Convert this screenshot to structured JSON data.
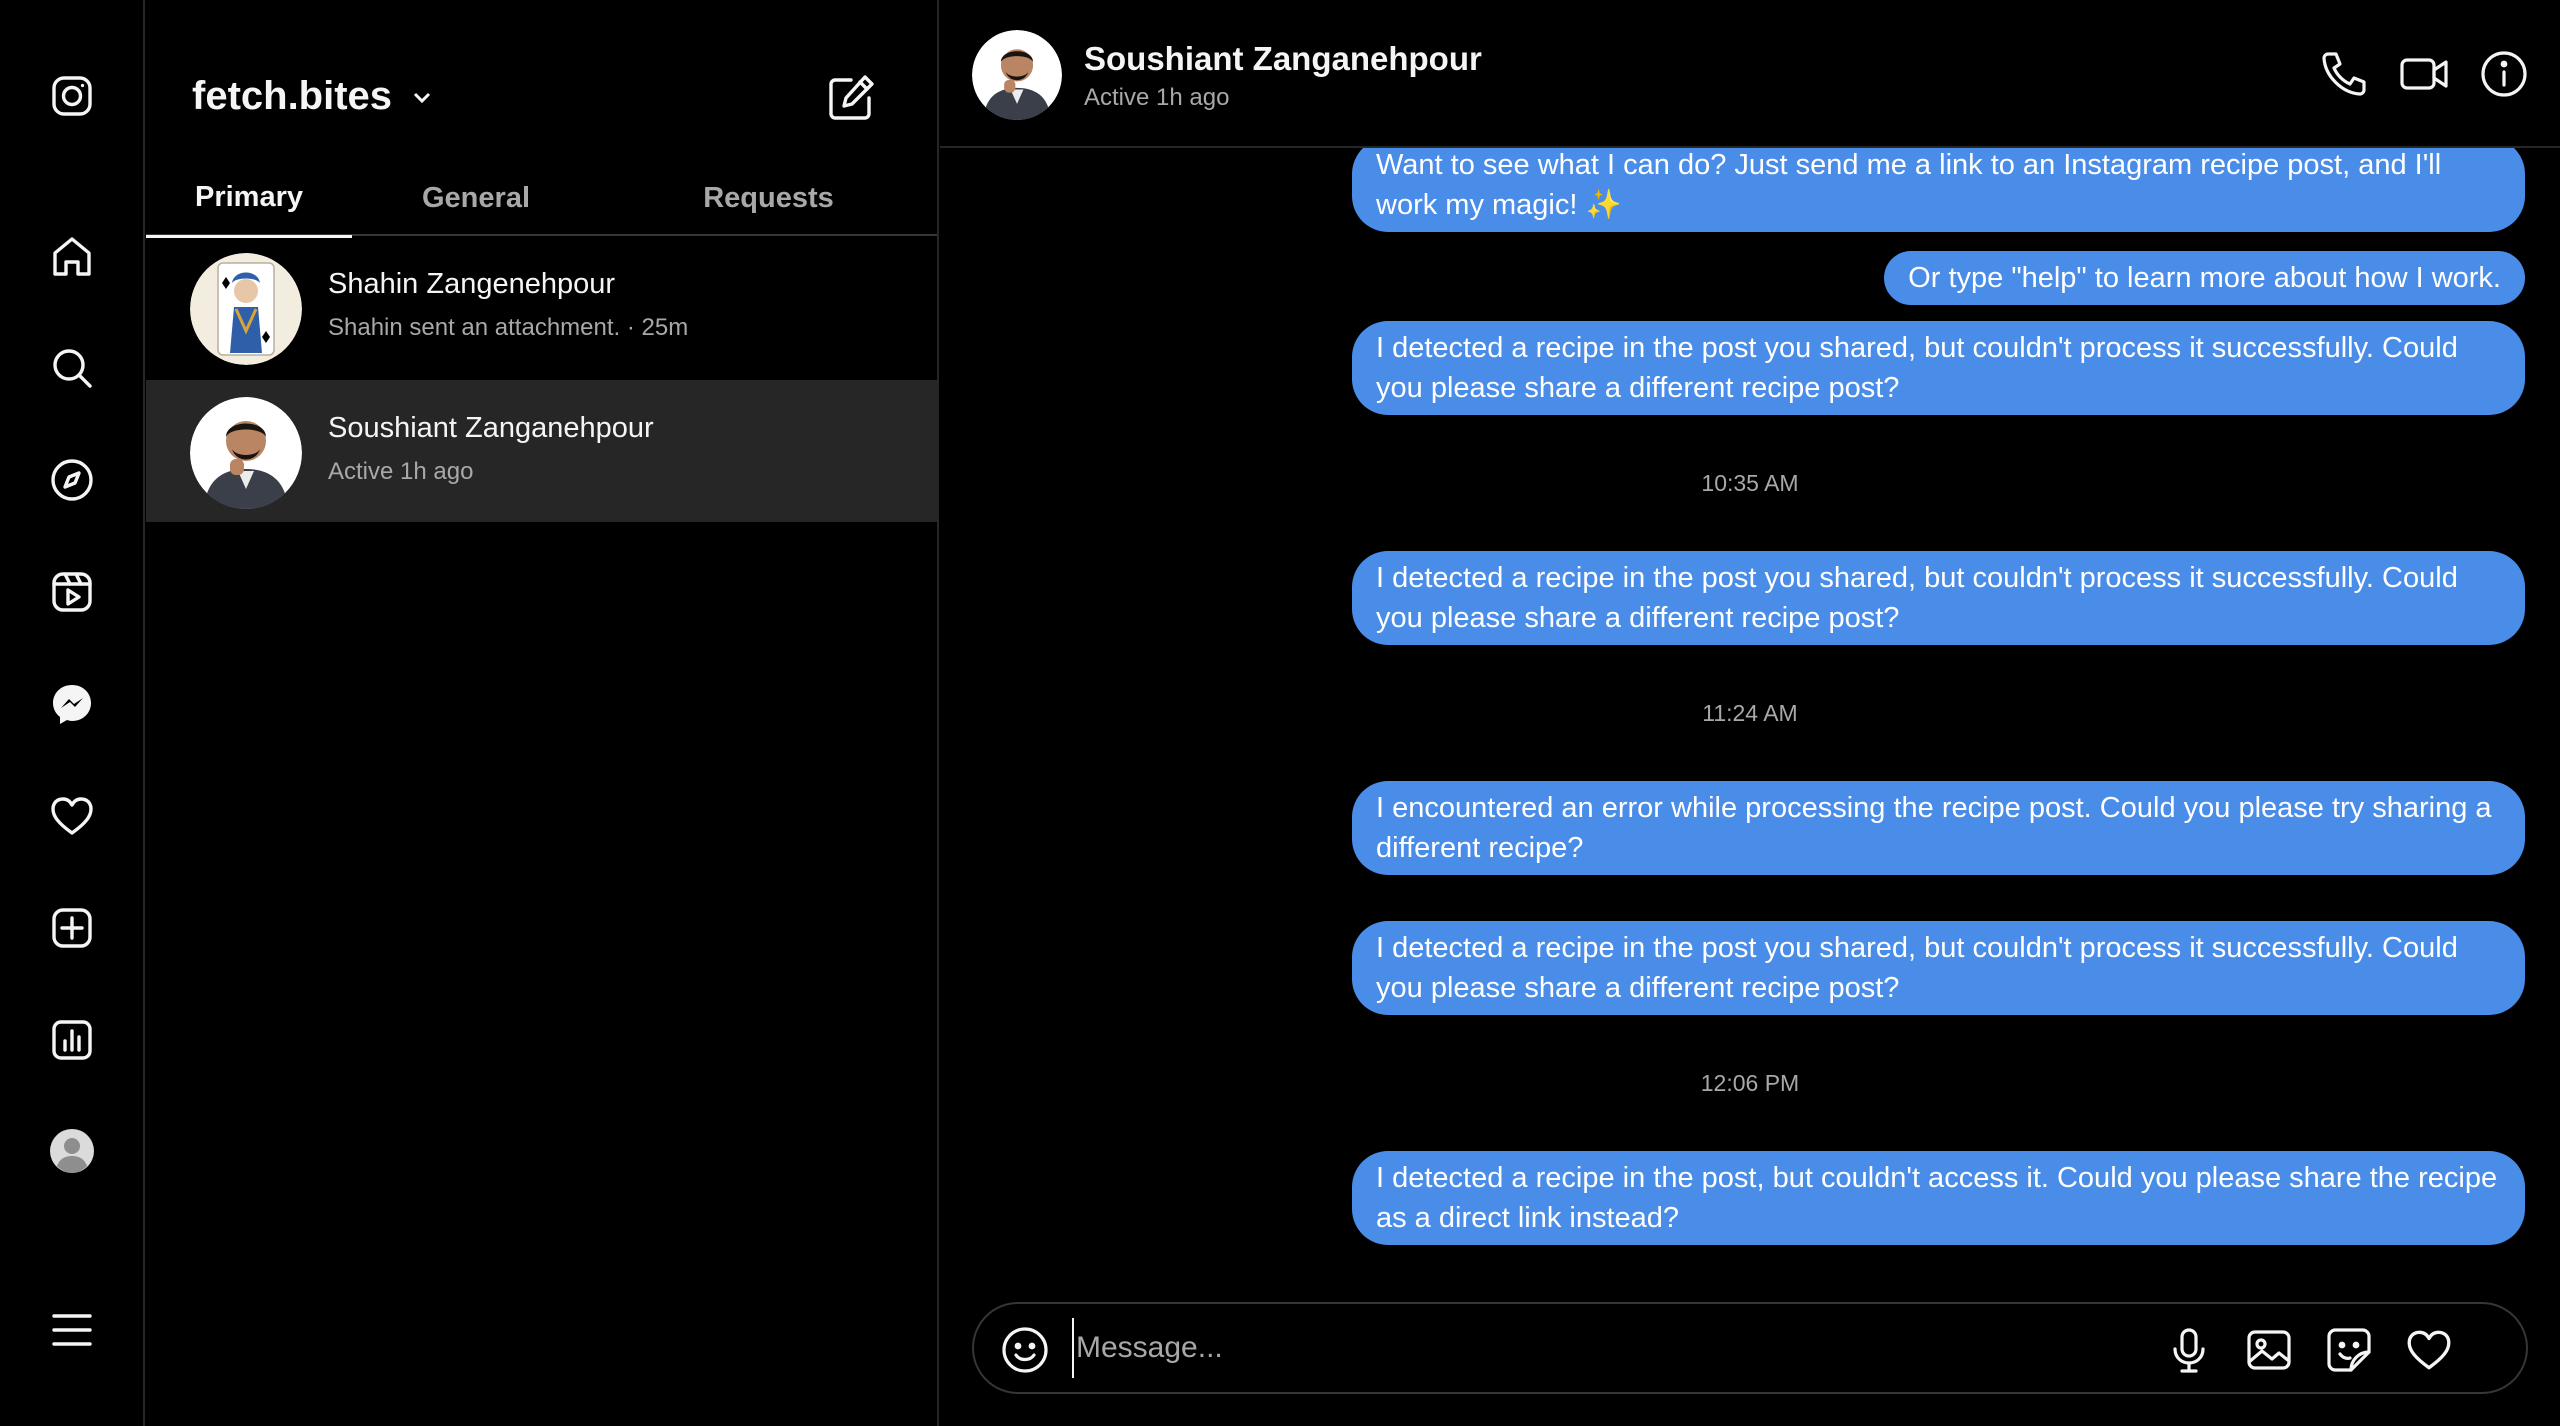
{
  "account": {
    "username": "fetch.bites"
  },
  "tabs": [
    {
      "label": "Primary",
      "active": true
    },
    {
      "label": "General",
      "active": false
    },
    {
      "label": "Requests",
      "active": false
    }
  ],
  "threads": [
    {
      "name": "Shahin Zangenehpour",
      "subtitle": "Shahin sent an attachment. · 25m",
      "selected": false
    },
    {
      "name": "Soushiant Zanganehpour",
      "subtitle": "Active 1h ago",
      "selected": true
    }
  ],
  "chat": {
    "name": "Soushiant Zanganehpour",
    "status": "Active 1h ago",
    "items": [
      {
        "kind": "message",
        "text": "Want to see what I can do? Just send me a link to an Instagram recipe post, and I'll work my magic! ✨"
      },
      {
        "kind": "message",
        "text": "Or type \"help\" to learn more about how I work."
      },
      {
        "kind": "message",
        "text": "I detected a recipe in the post you shared, but couldn't process it successfully. Could you please share a different recipe post?"
      },
      {
        "kind": "timestamp",
        "text": "10:35 AM"
      },
      {
        "kind": "message",
        "text": "I detected a recipe in the post you shared, but couldn't process it successfully. Could you please share a different recipe post?"
      },
      {
        "kind": "timestamp",
        "text": "11:24 AM"
      },
      {
        "kind": "message",
        "text": "I encountered an error while processing the recipe post. Could you please try sharing a different recipe?"
      },
      {
        "kind": "message",
        "text": "I detected a recipe in the post you shared, but couldn't process it successfully. Could you please share a different recipe post?"
      },
      {
        "kind": "timestamp",
        "text": "12:06 PM"
      },
      {
        "kind": "message",
        "text": "I detected a recipe in the post, but couldn't access it. Could you please share the recipe as a direct link instead?"
      }
    ]
  },
  "composer": {
    "placeholder": "Message...",
    "value": ""
  },
  "icons": {
    "nav": [
      "instagram-logo-icon",
      "home-icon",
      "search-icon",
      "explore-icon",
      "reels-icon",
      "messenger-icon",
      "heart-icon",
      "create-icon",
      "dashboard-icon",
      "profile-icon",
      "menu-icon"
    ],
    "header": [
      "phone-icon",
      "video-call-icon",
      "info-icon"
    ],
    "composer": [
      "emoji-icon",
      "microphone-icon",
      "image-icon",
      "sticker-icon",
      "heart-icon"
    ]
  },
  "colors": {
    "bubble": "#4a8de9",
    "background": "#000000",
    "selected_row": "#262626",
    "muted_text": "#a8a8a8"
  }
}
